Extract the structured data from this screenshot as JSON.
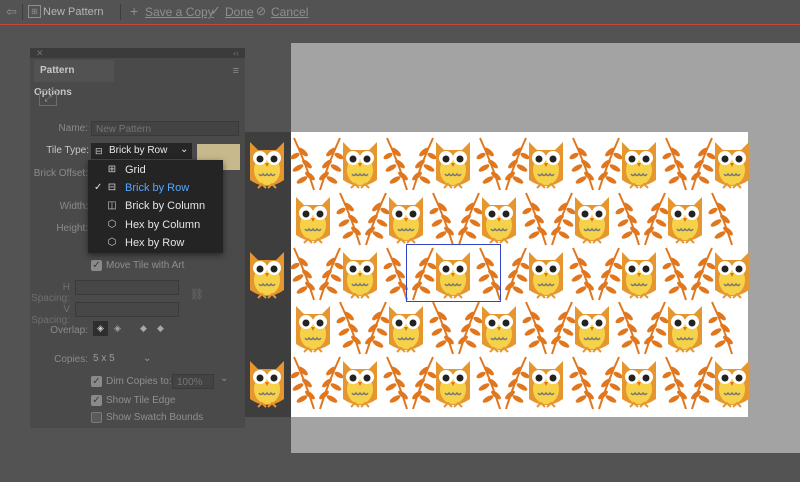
{
  "topbar": {
    "pattern_name": "New Pattern",
    "save_copy": "Save a Copy",
    "done": "Done",
    "cancel": "Cancel"
  },
  "panel": {
    "title": "Pattern Options",
    "name_label": "Name:",
    "name_value": "New Pattern",
    "tile_type_label": "Tile Type:",
    "tile_type_value": "Brick by Row",
    "brick_offset_label": "Brick Offset:",
    "width_label": "Width:",
    "height_label": "Height:",
    "move_tile_label": "Move Tile with Art",
    "h_spacing_label": "H Spacing:",
    "v_spacing_label": "V Spacing:",
    "overlap_label": "Overlap:",
    "copies_label": "Copies:",
    "copies_value": "5 x 5",
    "dim_label": "Dim Copies to:",
    "dim_value": "100%",
    "show_tile_edge_label": "Show Tile Edge",
    "show_swatch_bounds_label": "Show Swatch Bounds"
  },
  "tile_menu": {
    "items": [
      {
        "label": "Grid",
        "icon": "grid-icon",
        "selected": false
      },
      {
        "label": "Brick by Row",
        "icon": "brick-row-icon",
        "selected": true
      },
      {
        "label": "Brick by Column",
        "icon": "brick-column-icon",
        "selected": false
      },
      {
        "label": "Hex by Column",
        "icon": "hex-column-icon",
        "selected": false
      },
      {
        "label": "Hex by Row",
        "icon": "hex-row-icon",
        "selected": false
      }
    ]
  },
  "colors": {
    "owl_body": "#e6962f",
    "owl_belly": "#f6d24a",
    "leaf": "#e0771f",
    "selection": "#3345c7",
    "menu_selected": "#55a6ff"
  }
}
